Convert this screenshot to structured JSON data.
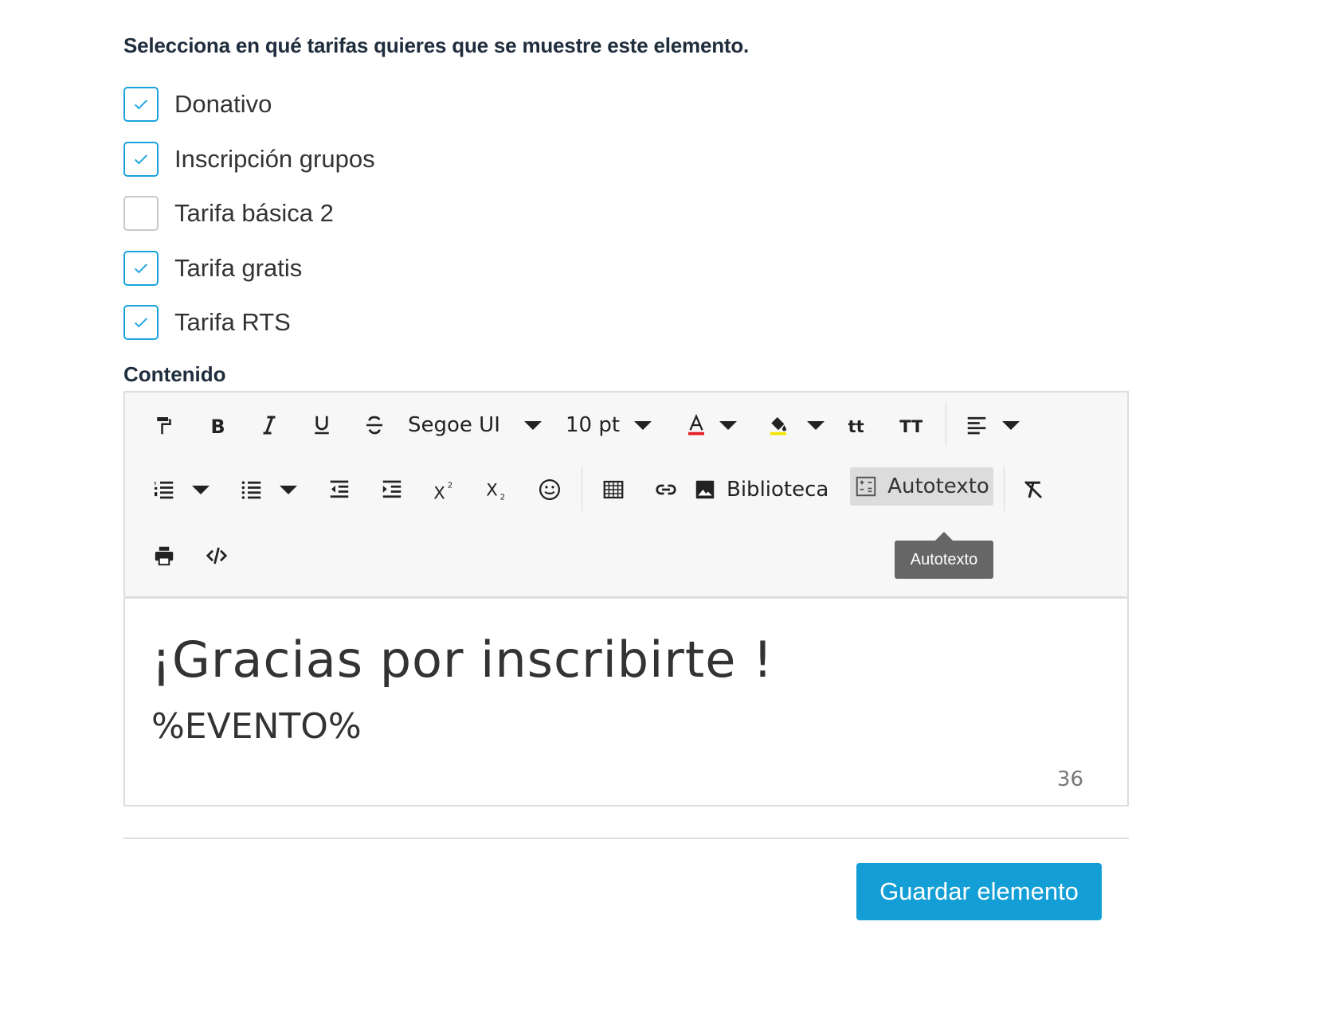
{
  "form": {
    "question": "Selecciona en qué tarifas quieres que se muestre este elemento.",
    "tariffs": [
      {
        "label": "Donativo",
        "checked": true
      },
      {
        "label": "Inscripción grupos",
        "checked": true
      },
      {
        "label": "Tarifa básica 2",
        "checked": false
      },
      {
        "label": "Tarifa gratis",
        "checked": true
      },
      {
        "label": "Tarifa RTS",
        "checked": true
      }
    ],
    "content_label": "Contenido",
    "save_label": "Guardar elemento"
  },
  "editor": {
    "font_family_value": "Segoe UI",
    "font_size_value": "10 pt",
    "library_label": "Biblioteca",
    "autotext_label": "Autotexto",
    "tooltip": "Autotexto",
    "content": {
      "line1": "¡Gracias por inscribirte   !",
      "line2": "%EVENTO%"
    },
    "char_count": "36"
  },
  "colors": {
    "accent": "#1aa3dc",
    "button": "#139fd6",
    "font_color_underline": "#e31e24",
    "highlight_underline": "#f2e600"
  }
}
